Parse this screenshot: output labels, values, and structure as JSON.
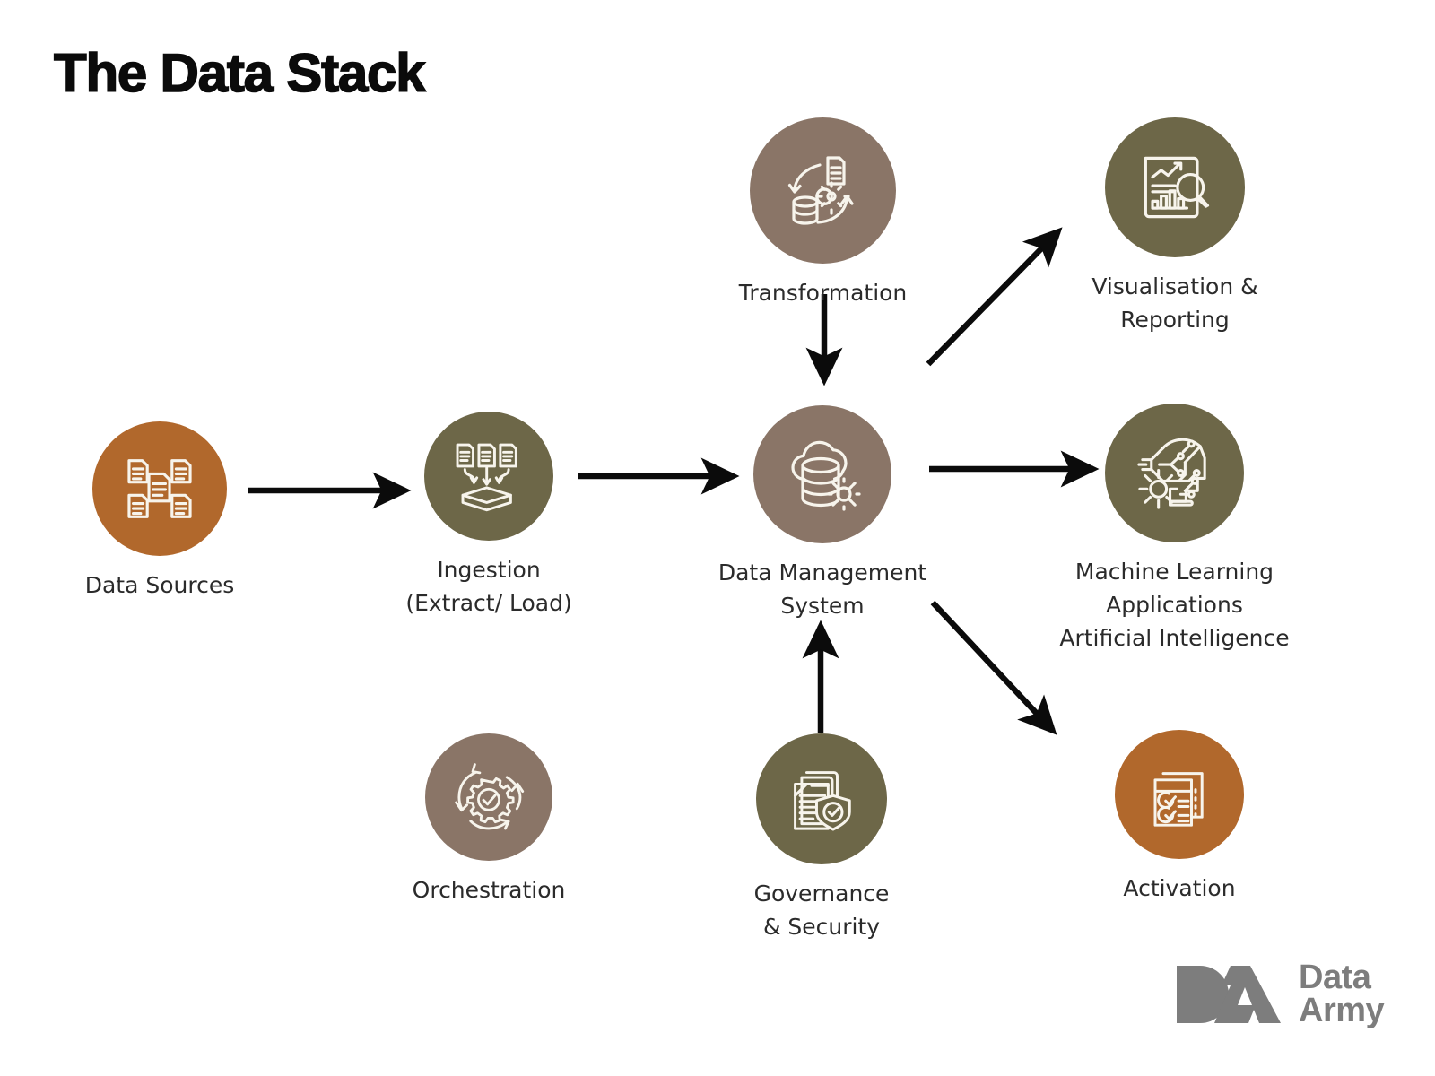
{
  "title": "The Data Stack",
  "colors": {
    "orange": "#b1682c",
    "olive": "#6d6748",
    "taupe": "#8a7567",
    "arrow": "#0b0b0b",
    "label_text": "#2b2b2b",
    "logo_grey": "#7d7d7d",
    "icon_stroke": "#f7f4ec",
    "background": "#ffffff"
  },
  "nodes": [
    {
      "id": "data-sources",
      "label_lines": [
        "Data Sources"
      ],
      "color": "#b1682c",
      "icon": "documents-network-icon"
    },
    {
      "id": "ingestion",
      "label_lines": [
        "Ingestion",
        "(Extract/ Load)"
      ],
      "color": "#6d6748",
      "icon": "documents-load-icon"
    },
    {
      "id": "transformation",
      "label_lines": [
        "Transformation"
      ],
      "color": "#8a7567",
      "icon": "transform-cycle-icon"
    },
    {
      "id": "data-management-system",
      "label_lines": [
        "Data Management",
        "System"
      ],
      "color": "#8a7567",
      "icon": "cloud-database-gear-icon"
    },
    {
      "id": "visualisation-reporting",
      "label_lines": [
        "Visualisation &",
        "Reporting"
      ],
      "color": "#6d6748",
      "icon": "report-magnifier-icon"
    },
    {
      "id": "machine-learning",
      "label_lines": [
        "Machine Learning",
        "Applications",
        "Artificial Intelligence"
      ],
      "color": "#6d6748",
      "icon": "ai-head-gear-icon"
    },
    {
      "id": "activation",
      "label_lines": [
        "Activation"
      ],
      "color": "#b1682c",
      "icon": "checklist-clipboard-icon"
    },
    {
      "id": "orchestration",
      "label_lines": [
        "Orchestration"
      ],
      "color": "#8a7567",
      "icon": "gear-cycle-check-icon"
    },
    {
      "id": "governance-security",
      "label_lines": [
        "Governance",
        "& Security"
      ],
      "color": "#6d6748",
      "icon": "document-shield-icon"
    }
  ],
  "flows": [
    {
      "id": "data-sources-to-ingestion",
      "from": "data-sources",
      "to": "ingestion"
    },
    {
      "id": "ingestion-to-data-management-system",
      "from": "ingestion",
      "to": "data-management-system"
    },
    {
      "id": "transformation-to-data-management-system",
      "from": "transformation",
      "to": "data-management-system"
    },
    {
      "id": "governance-to-data-management-system",
      "from": "governance-security",
      "to": "data-management-system"
    },
    {
      "id": "data-management-system-to-visualisation",
      "from": "data-management-system",
      "to": "visualisation-reporting"
    },
    {
      "id": "data-management-system-to-machine-learning",
      "from": "data-management-system",
      "to": "machine-learning"
    },
    {
      "id": "data-management-system-to-activation",
      "from": "data-management-system",
      "to": "activation"
    }
  ],
  "logo": {
    "mark": "da-monogram-icon",
    "line1": "Data",
    "line2": "Army"
  }
}
